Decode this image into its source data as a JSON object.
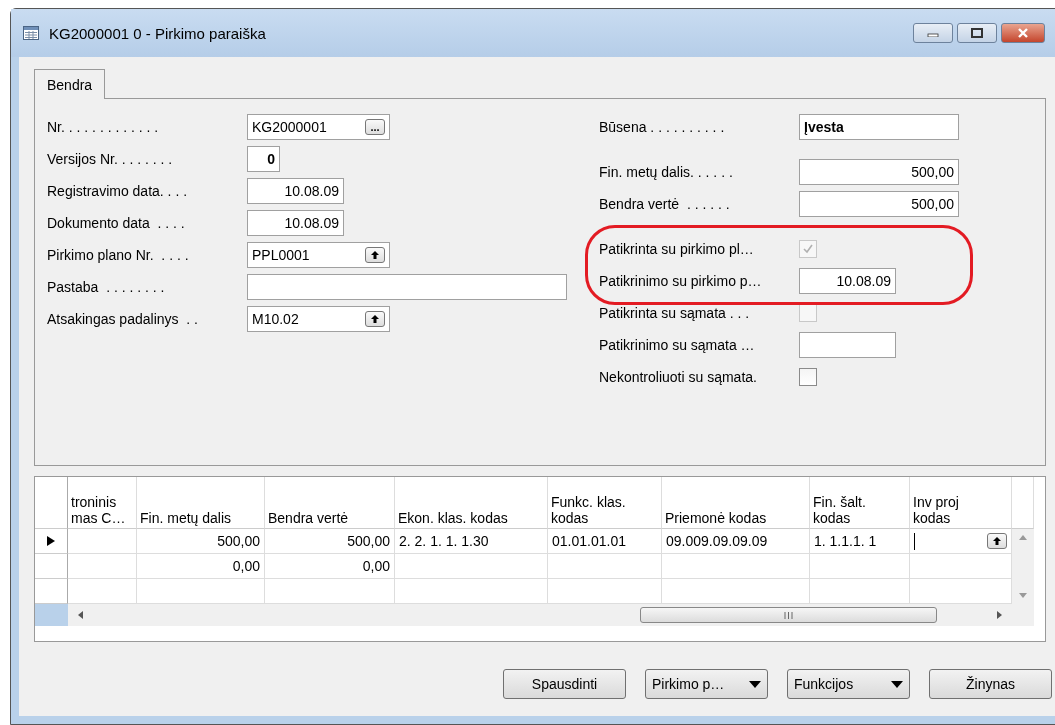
{
  "window": {
    "title": "KG2000001 0 - Pirkimo paraiška"
  },
  "tabs": [
    {
      "label": "Bendra",
      "selected": true
    }
  ],
  "left_fields": [
    {
      "label": "Nr. . . . . . . . . . . . .",
      "kind": "assist",
      "value": "KG2000001",
      "button": "..."
    },
    {
      "label": "Versijos Nr. . . . . . . .",
      "kind": "number",
      "value": "0"
    },
    {
      "label": "Registravimo data. . . .",
      "kind": "date",
      "value": "10.08.09"
    },
    {
      "label": "Dokumento data  . . . .",
      "kind": "date",
      "value": "10.08.09"
    },
    {
      "label": "Pirkimo plano Nr.  . . . .",
      "kind": "lookup",
      "value": "PPL0001"
    },
    {
      "label": "Pastaba  . . . . . . . .",
      "kind": "memo"
    },
    {
      "label": "Atsakingas padalinys  . .",
      "kind": "lookup",
      "value": "M10.02"
    }
  ],
  "right_groups": [
    [
      {
        "label": "Būsena . . . . . . . . . .",
        "kind": "status",
        "value": "Įvesta",
        "annotated": false
      }
    ],
    [
      {
        "label": "Fin. metų dalis. . . . . .",
        "kind": "amount",
        "value": "500,00",
        "annotated": false
      },
      {
        "label": "Bendra vertė  . . . . . .",
        "kind": "amount",
        "value": "500,00",
        "annotated": false
      }
    ],
    [
      {
        "label": "Patikrinta su pirkimo pl…",
        "kind": "checkbox",
        "checked": true,
        "disabled": true,
        "annotated": true
      },
      {
        "label": "Patikrinimo su pirkimo p…",
        "kind": "date",
        "value": "10.08.09",
        "annotated": true
      },
      {
        "label": "Patikrinta su sąmata . . .",
        "kind": "checkbox",
        "checked": false,
        "disabled": true,
        "annotated": false
      },
      {
        "label": "Patikrinimo su sąmata …",
        "kind": "date",
        "annotated": false
      },
      {
        "label": "Nekontroliuoti su sąmata.",
        "kind": "checkbox",
        "checked": false,
        "disabled": false,
        "annotated": false
      }
    ]
  ],
  "table": {
    "columns": [
      "troninis\nmas C…",
      "Fin. metų dalis",
      "Bendra vertė",
      "Ekon. klas. kodas",
      "Funkc. klas.\nkodas",
      "Priemonė kodas",
      "Fin. šalt.\nkodas",
      "Inv proj\nkodas"
    ],
    "rows": [
      {
        "selected": true,
        "cells": [
          "",
          "500,00",
          "500,00",
          "2. 2. 1. 1. 1.30",
          "01.01.01.01",
          "09.009.09.09.09",
          "1. 1.1.1. 1",
          ""
        ],
        "editing": true
      },
      {
        "selected": false,
        "cells": [
          "",
          "0,00",
          "0,00",
          "",
          "",
          "",
          "",
          ""
        ]
      },
      {
        "selected": false,
        "cells": [
          "",
          "",
          "",
          "",
          "",
          "",
          "",
          ""
        ]
      }
    ]
  },
  "buttons": [
    {
      "label": "Spausdinti",
      "menu": false
    },
    {
      "label": "Pirkimo p…",
      "menu": true
    },
    {
      "label": "Funkcijos",
      "menu": true
    },
    {
      "label": "Žinynas",
      "menu": false
    }
  ]
}
